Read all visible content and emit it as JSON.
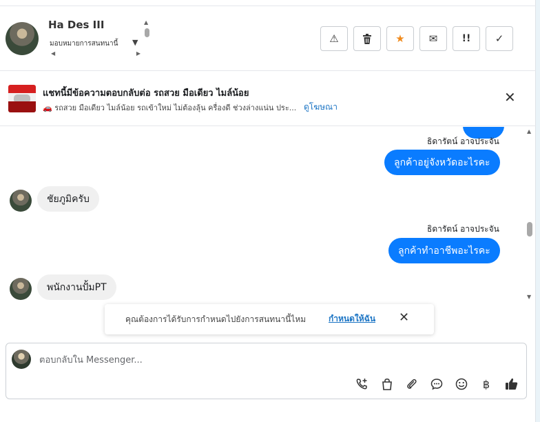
{
  "header": {
    "contact_name": "Ha Des III",
    "assign_label": "มอบหมายการสนทนานี้"
  },
  "actions": [
    {
      "name": "report-button",
      "icon": "warning-triangle-icon",
      "glyph": "⚠"
    },
    {
      "name": "delete-button",
      "icon": "trash-icon",
      "glyph": "🗑"
    },
    {
      "name": "star-button",
      "icon": "star-icon",
      "glyph": "★"
    },
    {
      "name": "mark-unread-button",
      "icon": "envelope-icon",
      "glyph": "✉"
    },
    {
      "name": "follow-up-button",
      "icon": "exclamation-icon",
      "glyph": "!!"
    },
    {
      "name": "mark-done-button",
      "icon": "checkmark-icon",
      "glyph": "✓"
    }
  ],
  "ad": {
    "title": "แชทนี้มีข้อความตอบกลับต่อ รถสวย มือเดียว ไมล์น้อย",
    "description": "รถสวย มือเดียว ไมล์น้อย รถเข้าใหม่ ไม่ต้องลุ้น ครื่องดี ช่วงล่างแน่น ประ...",
    "link": "ดูโฆษณา"
  },
  "messages": {
    "out1_sender": "ธิดารัตน์ อาจประจัน",
    "out1_text": "ลูกค้าอยู่จังหวัดอะไรคะ",
    "in1_text": "ชัยภูมิครับ",
    "out2_sender": "ธิดารัตน์ อาจประจัน",
    "out2_text": "ลูกค้าทำอาชีพอะไรคะ",
    "in2_text": "พนักงานปั้มPT"
  },
  "toast": {
    "text": "คุณต้องการได้รับการกำหนดไปยังการสนทนานี้ไหม",
    "link": "กำหนดให้ฉัน"
  },
  "composer": {
    "placeholder": "ตอบกลับใน Messenger...",
    "tools": [
      "phone-plus-icon",
      "shopping-bag-icon",
      "paperclip-icon",
      "chat-bubble-icon",
      "smiley-icon",
      "baht-icon",
      "thumbs-up-icon"
    ],
    "baht_glyph": "฿"
  },
  "colors": {
    "outgoing_bubble": "#0a7cff",
    "incoming_bubble": "#f0f0f0",
    "link": "#1b74c4",
    "star": "#f08a1c"
  }
}
